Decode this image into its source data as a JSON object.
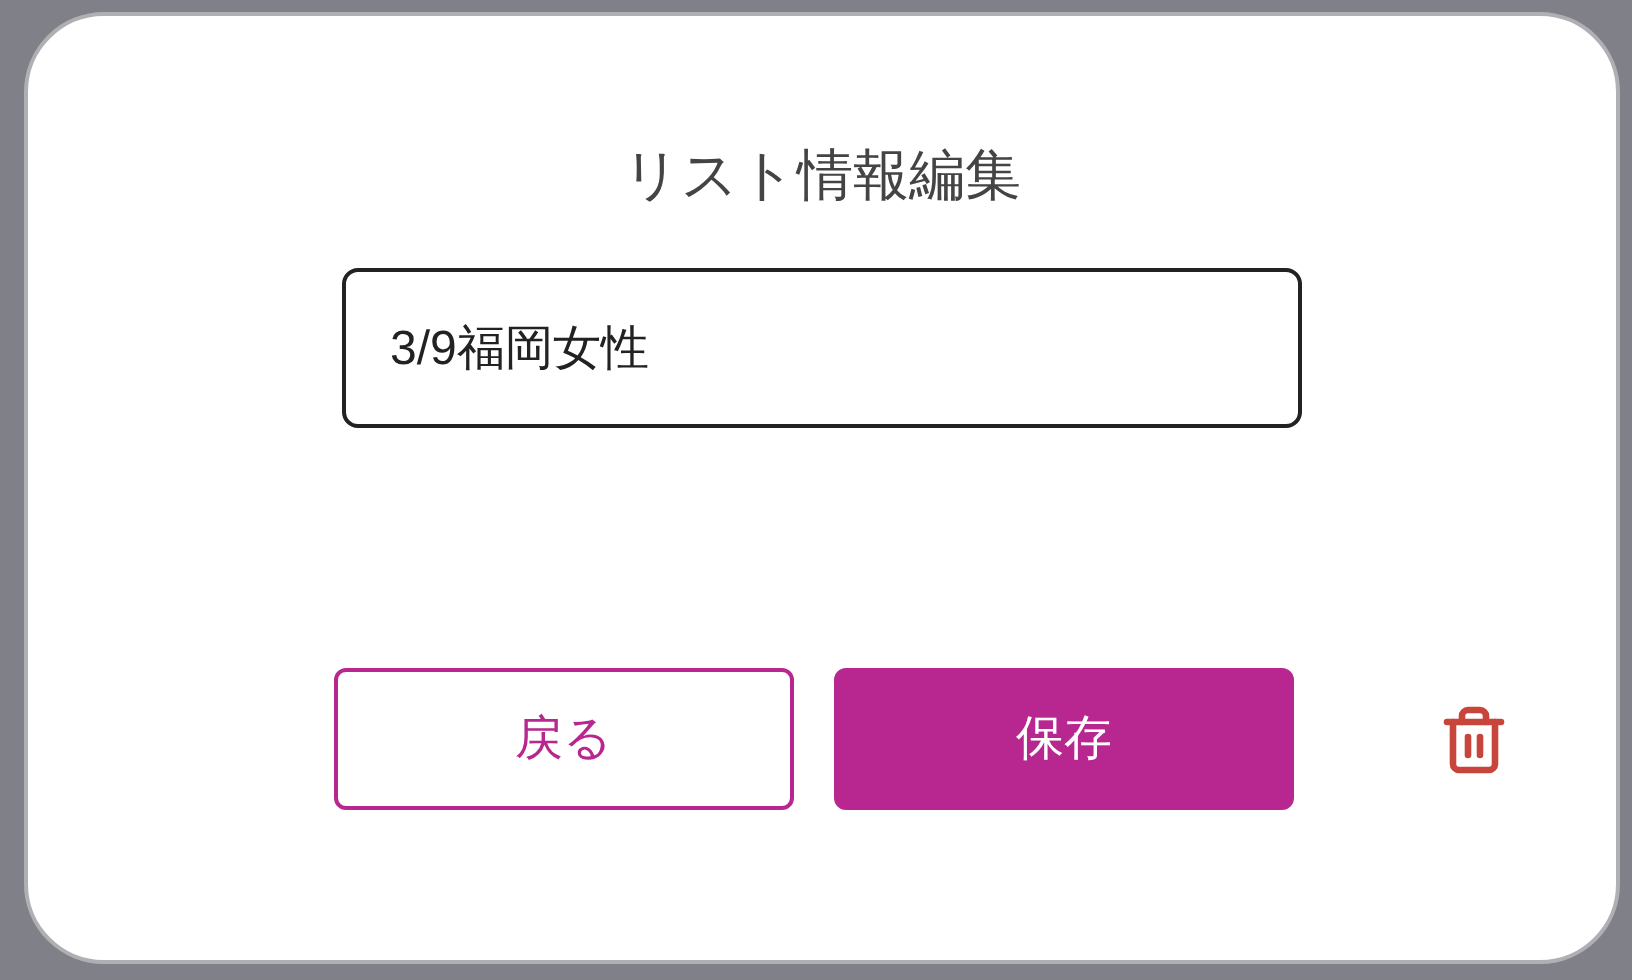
{
  "dialog": {
    "title": "リスト情報編集",
    "name_field": {
      "value": "3/9福岡女性"
    },
    "buttons": [
      {
        "kind": "secondary",
        "label": "戻る"
      },
      {
        "kind": "primary",
        "label": "保存"
      }
    ]
  }
}
